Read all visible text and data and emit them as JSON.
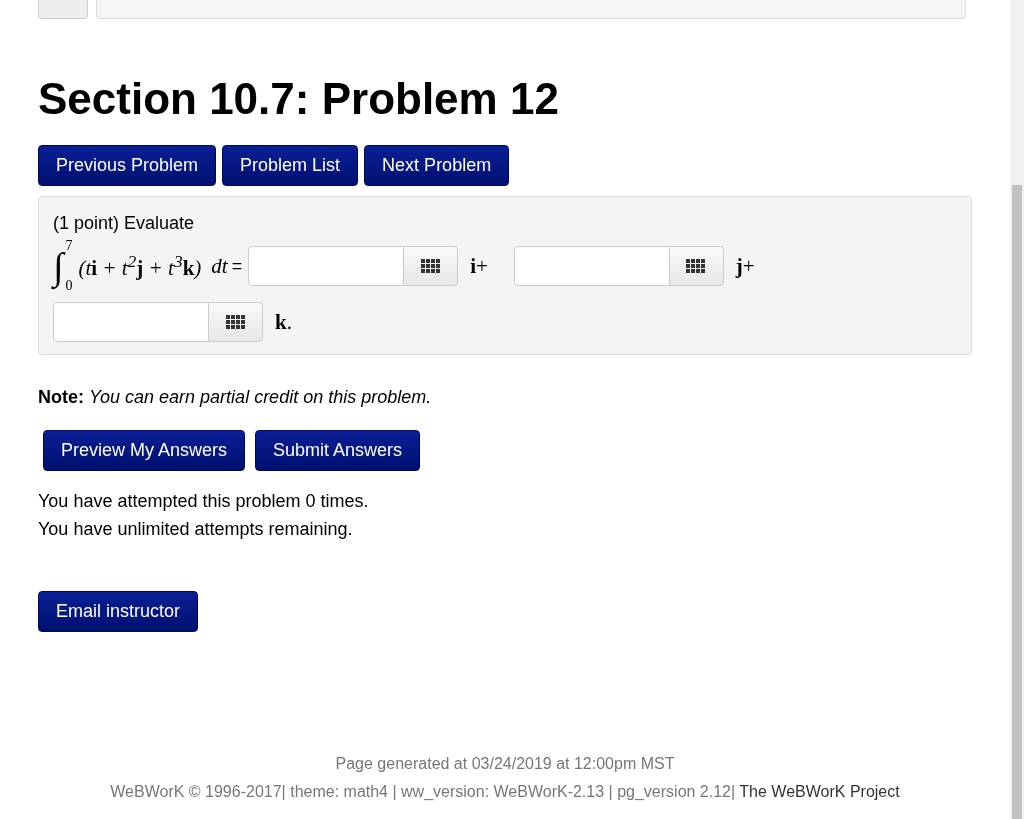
{
  "title": "Section 10.7: Problem 12",
  "nav_buttons": [
    "Previous Problem",
    "Problem List",
    "Next Problem"
  ],
  "problem": {
    "intro": "(1 point) Evaluate",
    "integral": {
      "sign": "∫",
      "upper": "7",
      "lower": "0",
      "integrand": "(t**i** + t$^{2}$**j** + t$^{3}$**k**)",
      "differential": "dt",
      "equals": "="
    },
    "answers": [
      {
        "suffix": "**i**+"
      },
      {
        "suffix": "**j**+"
      },
      {
        "suffix": "**k**."
      }
    ]
  },
  "note": {
    "label": "Note:",
    "text": "You can earn partial credit on this problem."
  },
  "submit_buttons": [
    "Preview My Answers",
    "Submit Answers"
  ],
  "attempts": [
    "You have attempted this problem 0 times.",
    "You have unlimited attempts remaining."
  ],
  "email_button": "Email instructor",
  "footer": {
    "generated": "Page generated at 03/24/2019 at 12:00pm MST",
    "info": "WeBWorK © 1996-2017| theme: math4 | ww_version: WeBWorK-2.13 | pg_version 2.12|",
    "link": "The WeBWorK Project"
  }
}
